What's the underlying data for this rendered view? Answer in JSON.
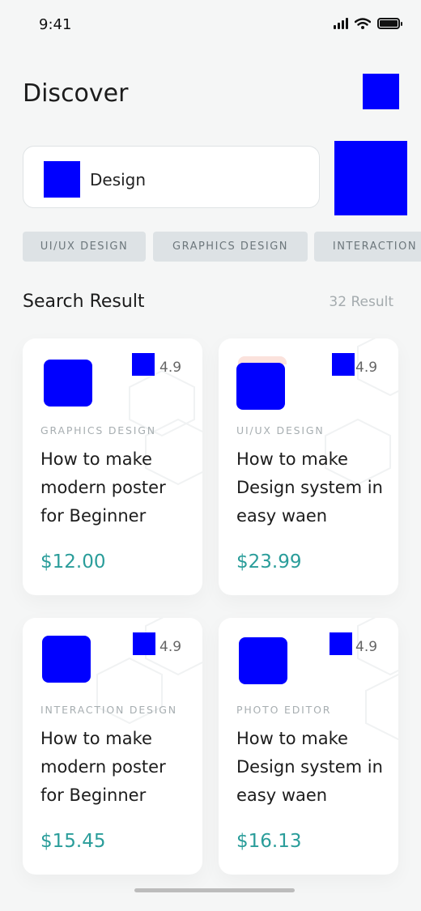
{
  "status_bar": {
    "time": "9:41",
    "icons": [
      "signal-icon",
      "wifi-icon",
      "battery-icon"
    ]
  },
  "header": {
    "title": "Discover",
    "action_icon": "notification-icon"
  },
  "search": {
    "value": "Design",
    "icon": "search-icon",
    "filter_icon": "filter-icon"
  },
  "chips": [
    "UI/UX DESIGN",
    "GRAPHICS DESIGN",
    "INTERACTION"
  ],
  "results": {
    "title": "Search Result",
    "count": "32 Result"
  },
  "cards": [
    {
      "category": "GRAPHICS DESIGN",
      "title": "How to make modern poster for Beginner",
      "rating": "4.9",
      "price": "$12.00"
    },
    {
      "category": "UI/UX DESIGN",
      "title": "How to make Design system in easy waen",
      "rating": "4.9",
      "price": "$23.99"
    },
    {
      "category": "INTERACTION DESIGN",
      "title": "How to make modern poster for Beginner",
      "rating": "4.9",
      "price": "$15.45"
    },
    {
      "category": "PHOTO EDITOR",
      "title": "How to make Design system in easy waen",
      "rating": "4.9",
      "price": "$16.13"
    }
  ],
  "colors": {
    "accent": "#2a9d9a",
    "placeholder_blue": "#0000ff",
    "chip_bg": "#dde2e5"
  }
}
